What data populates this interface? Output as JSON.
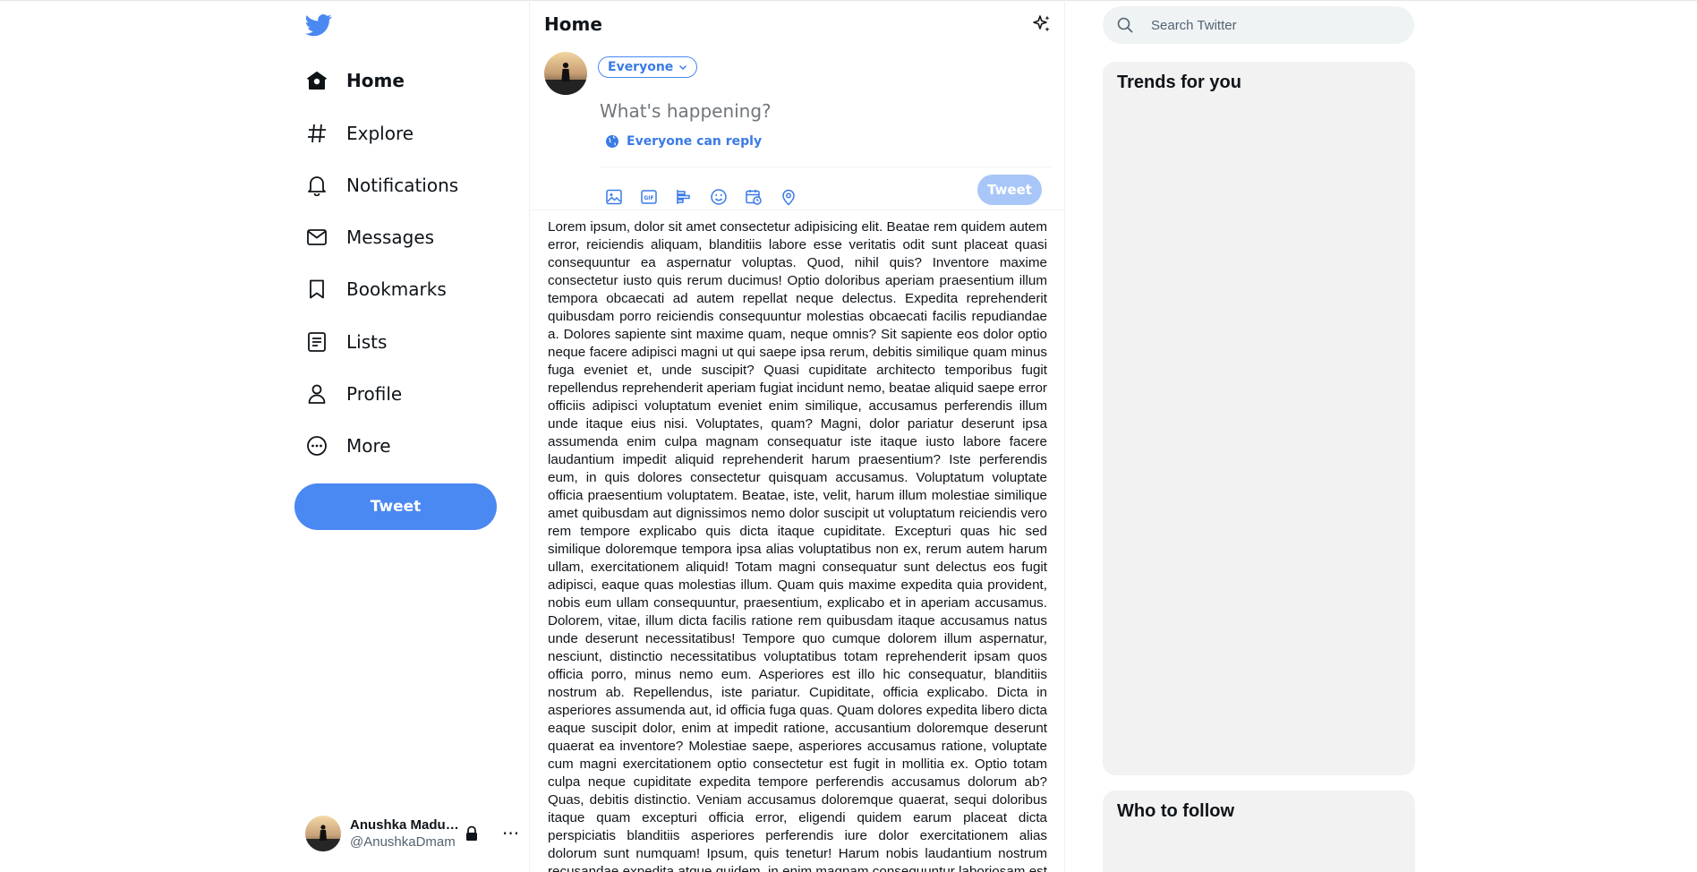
{
  "app": {
    "name": "Twitter",
    "brand_color": "#4a88f2"
  },
  "sidebar": {
    "logo_icon": "twitter-bird-icon",
    "items": [
      {
        "label": "Home",
        "icon": "home-icon",
        "active": true
      },
      {
        "label": "Explore",
        "icon": "hashtag-icon",
        "active": false
      },
      {
        "label": "Notifications",
        "icon": "bell-icon",
        "active": false
      },
      {
        "label": "Messages",
        "icon": "envelope-icon",
        "active": false
      },
      {
        "label": "Bookmarks",
        "icon": "bookmark-icon",
        "active": false
      },
      {
        "label": "Lists",
        "icon": "list-icon",
        "active": false
      },
      {
        "label": "Profile",
        "icon": "person-icon",
        "active": false
      },
      {
        "label": "More",
        "icon": "more-circle-icon",
        "active": false
      }
    ],
    "tweet_button": "Tweet"
  },
  "account": {
    "name": "Anushka Maduwantha",
    "handle": "@AnushkaDmam",
    "protected_icon": "lock-icon",
    "more_label": "···"
  },
  "main": {
    "title": "Home",
    "top_tweets_icon": "sparkle-icon",
    "composer": {
      "audience": "Everyone",
      "placeholder": "What's happening?",
      "reply_setting": "Everyone can reply",
      "tools": [
        "image-icon",
        "gif-icon",
        "poll-icon",
        "emoji-icon",
        "schedule-icon",
        "location-icon"
      ],
      "submit_label": "Tweet"
    },
    "feed_text": "Lorem ipsum, dolor sit amet consectetur adipisicing elit. Beatae rem quidem autem error, reiciendis aliquam, blanditiis labore esse veritatis odit sunt placeat quasi consequuntur ea aspernatur voluptas. Quod, nihil quis? Inventore maxime consectetur iusto quis rerum ducimus! Optio doloribus aperiam praesentium illum tempora obcaecati ad autem repellat neque delectus. Expedita reprehenderit quibusdam porro reiciendis consequuntur molestias obcaecati facilis repudiandae a. Dolores sapiente sint maxime quam, neque omnis? Sit sapiente eos dolor optio neque facere adipisci magni ut qui saepe ipsa rerum, debitis similique quam minus fuga eveniet et, unde suscipit? Quasi cupiditate architecto temporibus fugit repellendus reprehenderit aperiam fugiat incidunt nemo, beatae aliquid saepe error officiis adipisci voluptatum eveniet enim similique, accusamus perferendis illum unde itaque eius nisi. Voluptates, quam? Magni, dolor pariatur deserunt ipsa assumenda enim culpa magnam consequatur iste itaque iusto labore facere laudantium impedit aliquid reprehenderit harum praesentium? Iste perferendis eum, in quis dolores consectetur quisquam accusamus. Voluptatum voluptate officia praesentium voluptatem. Beatae, iste, velit, harum illum molestiae similique amet quibusdam aut dignissimos nemo dolor suscipit ut voluptatum reiciendis vero rem tempore explicabo quis dicta itaque cupiditate. Excepturi quas hic sed similique doloremque tempora ipsa alias voluptatibus non ex, rerum autem harum ullam, exercitationem aliquid! Totam magni consequatur sunt delectus eos fugit adipisci, eaque quas molestias illum. Quam quis maxime expedita quia provident, nobis eum ullam consequuntur, praesentium, explicabo et in aperiam accusamus. Dolorem, vitae, illum dicta facilis ratione rem quibusdam itaque accusamus natus unde deserunt necessitatibus! Tempore quo cumque dolorem illum aspernatur, nesciunt, distinctio necessitatibus voluptatibus totam reprehenderit ipsam quos officia porro, minus nemo eum. Asperiores est illo hic consequatur, blanditiis nostrum ab. Repellendus, iste pariatur. Cupiditate, officia explicabo. Dicta in asperiores assumenda aut, id officia fuga quas. Quam dolores expedita libero dicta eaque suscipit dolor, enim at impedit ratione, accusantium doloremque deserunt quaerat ea inventore? Molestiae saepe, asperiores accusamus ratione, voluptate cum magni exercitationem optio consectetur est fugit in mollitia ex. Optio totam culpa neque cupiditate expedita tempore perferendis accusamus dolorum ab? Quas, debitis distinctio. Veniam accusamus doloremque quaerat, sequi doloribus itaque quam excepturi officia error, eligendi quidem earum placeat dicta perspiciatis blanditiis asperiores perferendis iure dolor exercitationem alias dolorum sunt numquam! Ipsum, quis tenetur! Harum nobis laudantium nostrum recusandae expedita atque quidem, in enim magnam consequuntur laboriosam est dolores"
  },
  "right": {
    "search_placeholder": "Search Twitter",
    "trends_title": "Trends for you",
    "follow_title": "Who to follow"
  }
}
